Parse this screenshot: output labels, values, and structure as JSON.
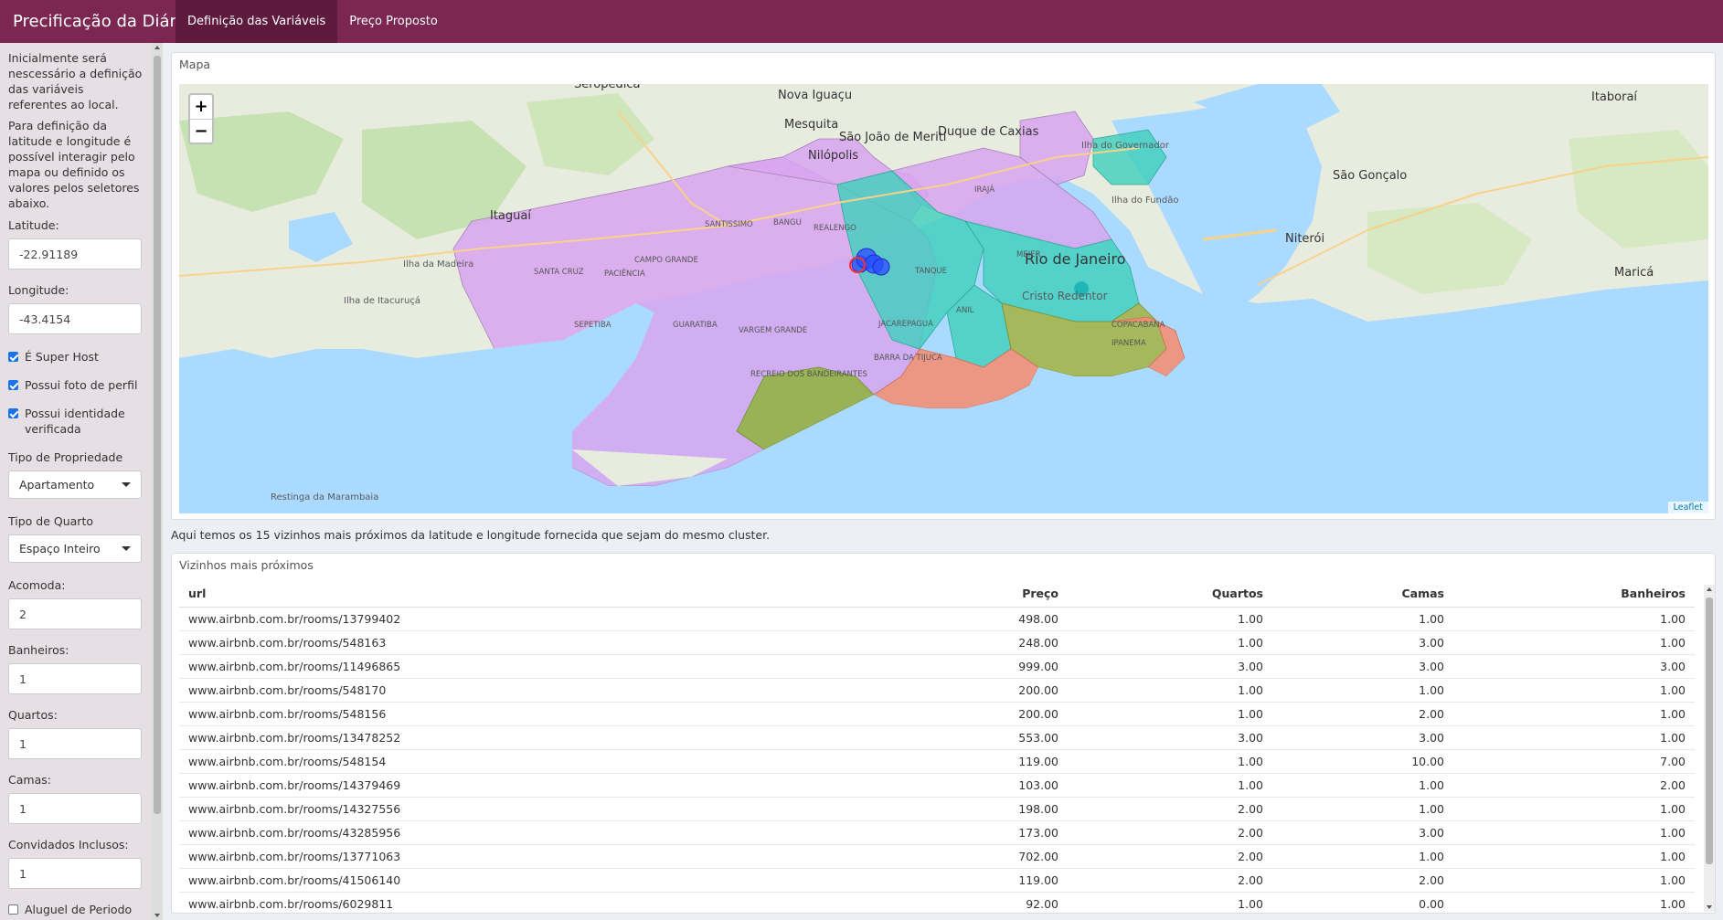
{
  "navbar": {
    "brand": "Precificação da Diária",
    "tabs": [
      {
        "label": "Definição das Variáveis",
        "active": true
      },
      {
        "label": "Preço Proposto",
        "active": false
      }
    ],
    "color": "#7b2752"
  },
  "sidebar": {
    "intro1": "Inicialmente será nescessário a definição das variáveis referentes ao local.",
    "intro2": "Para definição da latitude e longitude é possível interagir pelo mapa ou definido os valores pelos seletores abaixo.",
    "latitude": {
      "label": "Latitude:",
      "value": "-22.91189"
    },
    "longitude": {
      "label": "Longitude:",
      "value": "-43.4154"
    },
    "checks": [
      {
        "label": "É Super Host",
        "checked": true
      },
      {
        "label": "Possui foto de perfil",
        "checked": true
      },
      {
        "label": "Possui identidade verificada",
        "checked": true
      }
    ],
    "property_type": {
      "label": "Tipo de Propriedade",
      "value": "Apartamento"
    },
    "room_type": {
      "label": "Tipo de Quarto",
      "value": "Espaço Inteiro"
    },
    "accommodates": {
      "label": "Acomoda:",
      "value": "2"
    },
    "bathrooms": {
      "label": "Banheiros:",
      "value": "1"
    },
    "bedrooms": {
      "label": "Quartos:",
      "value": "1"
    },
    "beds": {
      "label": "Camas:",
      "value": "1"
    },
    "guests": {
      "label": "Convidados Inclusos:",
      "value": "1"
    },
    "long_rent": {
      "label": "Aluguel de Periodo Longo",
      "checked": false
    }
  },
  "map_panel": {
    "title": "Mapa",
    "zoom_in": "+",
    "zoom_out": "−",
    "attribution": "Leaflet",
    "labels": {
      "city": "Rio de Janeiro",
      "nova_iguacu": "Nova Iguaçu",
      "sao_joao": "São João de Meriti",
      "duque": "Duque de Caxias",
      "niteroi": "Niterói",
      "sao_goncalo": "São Gonçalo",
      "itaguai": "Itaguaí",
      "itaborai": "Itaboraí",
      "marica": "Maricá",
      "nilopolis": "Nilópolis",
      "mesquita": "Mesquita",
      "seropedica": "Seropédica",
      "campo_grande": "CAMPO GRANDE",
      "santa_cruz": "SANTA CRUZ",
      "paciencia": "PACIÊNCIA",
      "santissimo": "SANTISSIMO",
      "bangu": "BANGU",
      "realengo": "REALENGO",
      "sepetiba": "SEPETIBA",
      "guaratiba": "GUARATIBA",
      "vargem": "VARGEM GRANDE",
      "recreio": "RECREIO DOS BANDEIRANTES",
      "barra": "BARRA DA TIJUCA",
      "jacarepagua": "JACAREPAGUÁ",
      "tanque": "TANQUE",
      "anil": "ANIL",
      "meier": "MEIER",
      "iraja": "IRAJÁ",
      "copacabana": "COPACABANA",
      "ipanema": "IPANEMA",
      "cristo": "Cristo Redentor",
      "ilha_gov": "Ilha do Governador",
      "ilha_fundao": "Ilha do Fundão",
      "ilha_madeira": "Ilha da Madeira",
      "ilha_itacuruca": "Ilha de Itacuruçá",
      "restinga": "Restinga da Marambaia"
    }
  },
  "caption": "Aqui temos os 15 vizinhos mais próximos da latitude e longitude fornecida que sejam do mesmo cluster.",
  "table_panel": {
    "title": "Vizinhos mais próximos",
    "columns": [
      "url",
      "Preço",
      "Quartos",
      "Camas",
      "Banheiros"
    ],
    "rows": [
      [
        "www.airbnb.com.br/rooms/13799402",
        "498.00",
        "1.00",
        "1.00",
        "1.00"
      ],
      [
        "www.airbnb.com.br/rooms/548163",
        "248.00",
        "1.00",
        "3.00",
        "1.00"
      ],
      [
        "www.airbnb.com.br/rooms/11496865",
        "999.00",
        "3.00",
        "3.00",
        "3.00"
      ],
      [
        "www.airbnb.com.br/rooms/548170",
        "200.00",
        "1.00",
        "1.00",
        "1.00"
      ],
      [
        "www.airbnb.com.br/rooms/548156",
        "200.00",
        "1.00",
        "2.00",
        "1.00"
      ],
      [
        "www.airbnb.com.br/rooms/13478252",
        "553.00",
        "3.00",
        "3.00",
        "1.00"
      ],
      [
        "www.airbnb.com.br/rooms/548154",
        "119.00",
        "1.00",
        "10.00",
        "7.00"
      ],
      [
        "www.airbnb.com.br/rooms/14379469",
        "103.00",
        "1.00",
        "1.00",
        "2.00"
      ],
      [
        "www.airbnb.com.br/rooms/14327556",
        "198.00",
        "2.00",
        "1.00",
        "1.00"
      ],
      [
        "www.airbnb.com.br/rooms/43285956",
        "173.00",
        "2.00",
        "3.00",
        "1.00"
      ],
      [
        "www.airbnb.com.br/rooms/13771063",
        "702.00",
        "2.00",
        "1.00",
        "1.00"
      ],
      [
        "www.airbnb.com.br/rooms/41506140",
        "119.00",
        "2.00",
        "2.00",
        "1.00"
      ],
      [
        "www.airbnb.com.br/rooms/6029811",
        "92.00",
        "1.00",
        "0.00",
        "1.00"
      ]
    ]
  }
}
